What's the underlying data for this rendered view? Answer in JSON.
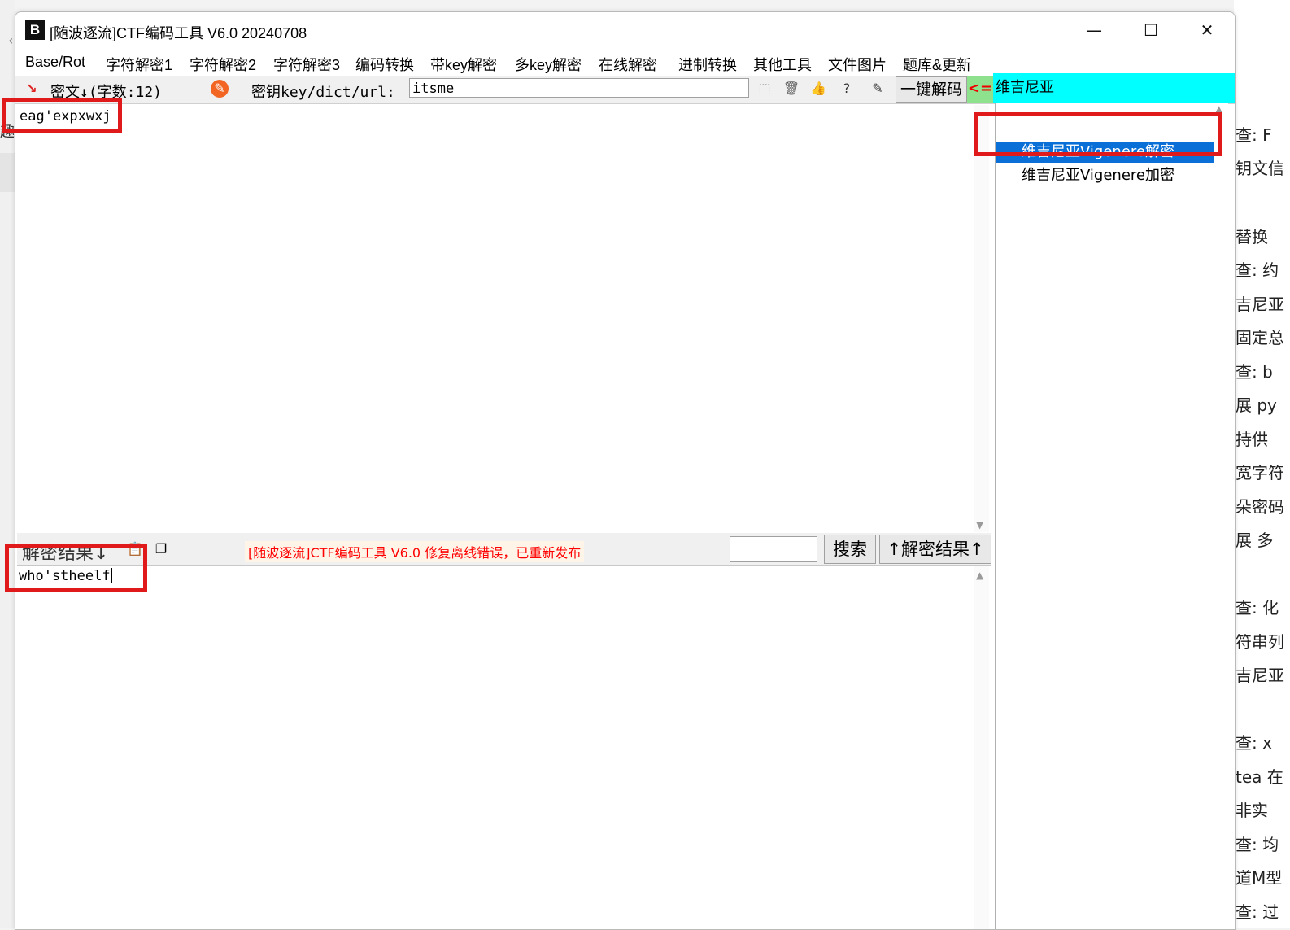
{
  "window": {
    "title": "[随波逐流]CTF编码工具 V6.0 20240708",
    "icon_label": "B",
    "controls": [
      "—",
      "☐",
      "✕"
    ]
  },
  "menu": [
    "Base/Rot",
    "字符解密1",
    "字符解密2",
    "字符解密3",
    "编码转换",
    "带key解密",
    "多key解密",
    "在线解密",
    "进制转换",
    "其他工具",
    "文件图片",
    "题库&更新"
  ],
  "toolbar": {
    "cipher_label": "密文↓(字数:12)",
    "key_label": "密钥key/dict/url:",
    "key_value": "itsme",
    "onekey_label": "一键解码",
    "arrow": "<=",
    "algo_selected": "维吉尼亚"
  },
  "cipher": {
    "text": "eag'expxwxj"
  },
  "algo_list": [
    "维吉尼亚Vigenere解密",
    "维吉尼亚Vigenere加密"
  ],
  "result_bar": {
    "label": "解密结果↓",
    "notice": "[随波逐流]CTF编码工具 V6.0 修复离线错误，已重新发布",
    "search_label": "搜索",
    "up_label": "↑解密结果↑"
  },
  "result": {
    "text": "who'stheelf"
  },
  "background_right": [
    "查: F",
    "钥文信",
    "替换",
    "查: 约",
    "吉尼亚",
    "固定总",
    "查: b",
    "展 py",
    "持供",
    "宽字符",
    "朵密码",
    "展 多",
    "查: 化",
    "符串列",
    "吉尼亚",
    "查: x",
    "tea 在",
    "非实",
    "查: 均",
    "道M型",
    "查: 过"
  ],
  "background_left": {
    "glyph": "趣",
    "mark": "‹"
  }
}
